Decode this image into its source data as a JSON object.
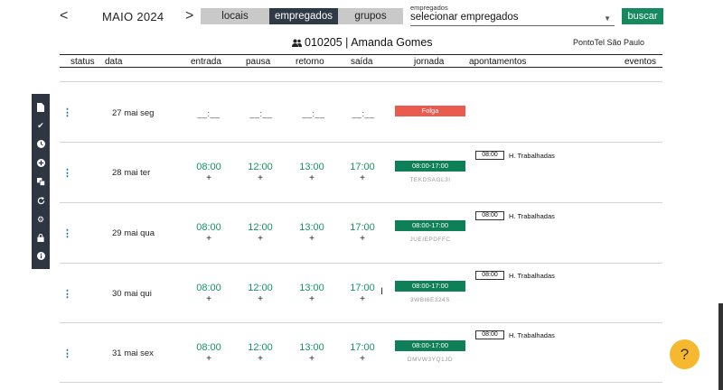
{
  "toolbar": {
    "prev_arrow": "<",
    "next_arrow": ">",
    "month": "MAIO 2024",
    "tabs": [
      "locais",
      "empregados",
      "grupos"
    ],
    "employee_select_label": "empregados",
    "employee_select_value": "selecionar empregados",
    "search_button": "buscar"
  },
  "employee": {
    "title": "010205 | Amanda Gomes",
    "company": "PontoTel São Paulo"
  },
  "columns": [
    "status",
    "data",
    "entrada",
    "pausa",
    "retorno",
    "saída",
    "jornada",
    "apontamentos",
    "eventos"
  ],
  "rows": [
    {
      "date": "27 mai seg",
      "entrada": "__:__",
      "pausa": "__:__",
      "retorno": "__:__",
      "saida": "__:__",
      "jornada": "Folga"
    },
    {
      "date": "28 mai ter",
      "entrada": "08:00",
      "pausa": "12:00",
      "retorno": "13:00",
      "saida": "17:00",
      "plus": "+",
      "jornada": "08:00-17:00",
      "code": "TEKDSAGL3I",
      "hours_value": "08:00",
      "hours_label": "H. Trabalhadas"
    },
    {
      "date": "29 mai qua",
      "entrada": "08:00",
      "pausa": "12:00",
      "retorno": "13:00",
      "saida": "17:00",
      "plus": "+",
      "jornada": "08:00-17:00",
      "code": "JUEIEPDFFC",
      "hours_value": "08:00",
      "hours_label": "H. Trabalhadas"
    },
    {
      "date": "30 mai qui",
      "entrada": "08:00",
      "pausa": "12:00",
      "retorno": "13:00",
      "saida": "17:00",
      "plus": "+",
      "jornada": "08:00-17:00",
      "code": "3WBI6E324S",
      "hours_value": "08:00",
      "hours_label": "H. Trabalhadas"
    },
    {
      "date": "31 mai sex",
      "entrada": "08:00",
      "pausa": "12:00",
      "retorno": "13:00",
      "saida": "17:00",
      "plus": "+",
      "jornada": "08:00-17:00",
      "code": "DMVW3YQ1JD",
      "hours_value": "08:00",
      "hours_label": "H. Trabalhadas"
    }
  ],
  "sidebar_icons": [
    "file-icon",
    "check-icon",
    "clock-icon",
    "plus-circle-icon",
    "clone-icon",
    "refresh-icon",
    "gear-icon",
    "lock-icon",
    "info-icon"
  ],
  "help_label": "?",
  "colors": {
    "accent_green": "#158a5f",
    "dark_nav": "#303a46",
    "folga_red": "#ea5a4f",
    "help_yellow": "#f5b82e"
  }
}
